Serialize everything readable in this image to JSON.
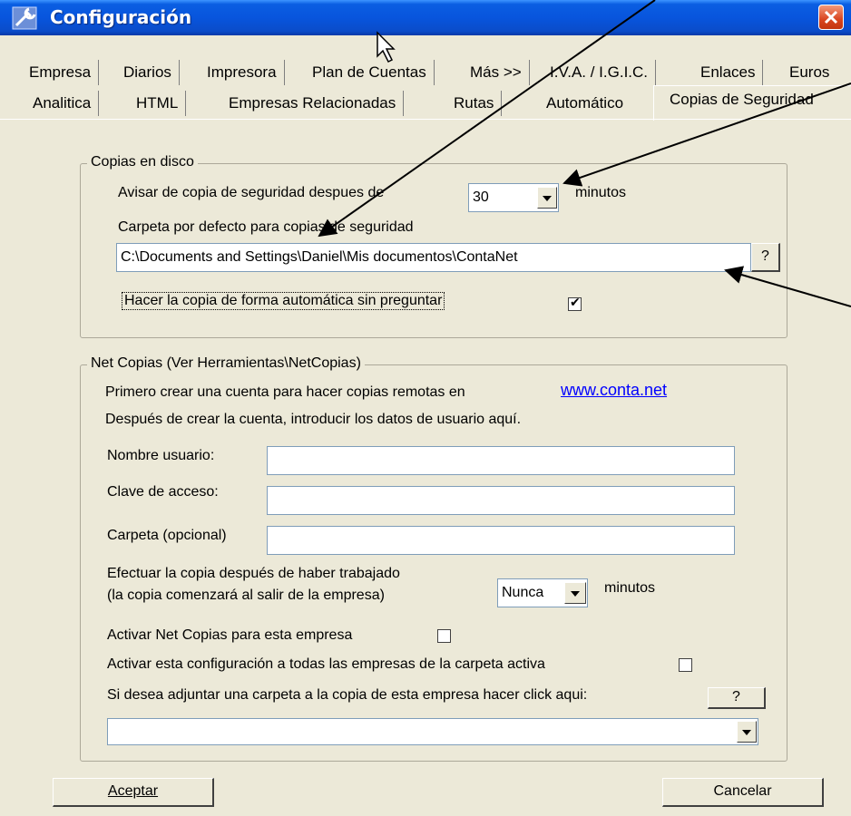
{
  "window": {
    "title": "Configuración"
  },
  "tabs_row1": [
    {
      "label": "Empresa"
    },
    {
      "label": "Diarios"
    },
    {
      "label": "Impresora"
    },
    {
      "label": "Plan de Cuentas"
    },
    {
      "label": "Más >>"
    },
    {
      "label": "I.V.A. / I.G.I.C."
    },
    {
      "label": "Enlaces"
    },
    {
      "label": "Euros"
    }
  ],
  "tabs_row2": [
    {
      "label": "Analitica"
    },
    {
      "label": "HTML"
    },
    {
      "label": "Empresas Relacionadas"
    },
    {
      "label": "Rutas"
    },
    {
      "label": "Automático"
    },
    {
      "label": "Copias de Seguridad"
    }
  ],
  "active_tab": "Copias de Seguridad",
  "disk": {
    "legend": "Copias en disco",
    "warn_label": "Avisar de copia de seguridad despues de",
    "warn_value": "30",
    "warn_unit": "minutos",
    "folder_label": "Carpeta por defecto para copias de seguridad",
    "folder_value": "C:\\Documents and Settings\\Daniel\\Mis documentos\\ContaNet",
    "browse_label": "?",
    "auto_label": "Hacer la copia de forma automática sin preguntar",
    "auto_checked": true
  },
  "net": {
    "legend": "Net Copias (Ver Herramientas\\NetCopias)",
    "intro1": "Primero crear una cuenta para hacer copias remotas en",
    "link": "www.conta.net",
    "intro2": "Después de crear la cuenta, introducir los datos de usuario aquí.",
    "user_label": "Nombre usuario:",
    "user_value": "",
    "pass_label": "Clave de acceso:",
    "pass_value": "",
    "folder_label": "Carpeta (opcional)",
    "folder_value": "",
    "after_label1": "Efectuar la copia después de haber trabajado",
    "after_label2": "(la copia comenzará al salir de la empresa)",
    "after_value": "Nunca",
    "after_unit": "minutos",
    "activate_label": "Activar Net Copias para esta empresa",
    "activate_checked": false,
    "apply_all_label": "Activar esta configuración a todas las empresas de la carpeta activa",
    "apply_all_checked": false,
    "attach_label": "Si desea adjuntar una carpeta a la copia de esta empresa hacer click aqui:",
    "attach_btn": "?",
    "attach_value": ""
  },
  "buttons": {
    "accept": "Aceptar",
    "cancel": "Cancelar"
  }
}
